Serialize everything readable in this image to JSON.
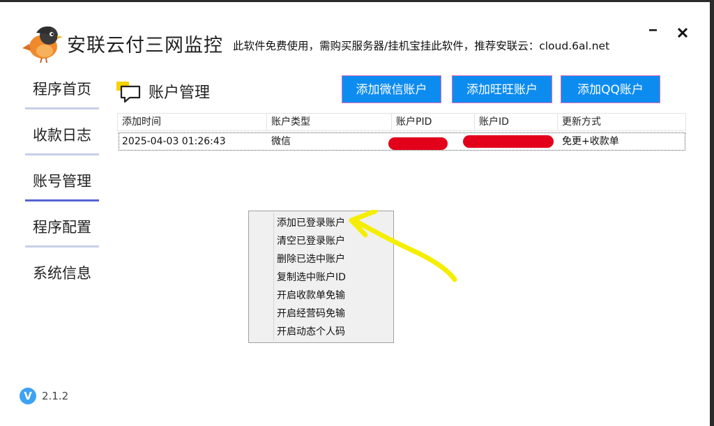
{
  "window": {
    "title": "安联云付三网监控",
    "tagline": "此软件免费使用，需购买服务器/挂机宝挂此软件，推荐安联云：cloud.6al.net",
    "minimize_glyph": "–",
    "close_glyph": "✕"
  },
  "sidebar": {
    "items": [
      {
        "label": "程序首页",
        "active": false
      },
      {
        "label": "收款日志",
        "active": false
      },
      {
        "label": "账号管理",
        "active": true
      },
      {
        "label": "程序配置",
        "active": false
      },
      {
        "label": "系统信息",
        "active": false
      }
    ]
  },
  "main": {
    "section_title": "账户管理",
    "buttons": {
      "add_wechat": "添加微信账户",
      "add_wangwang": "添加旺旺账户",
      "add_qq": "添加QQ账户"
    },
    "table": {
      "columns": [
        "添加时间",
        "账户类型",
        "账户PID",
        "账户ID",
        "更新方式"
      ],
      "rows": [
        {
          "time": "2025-04-03 01:26:43",
          "type": "微信",
          "pid": "",
          "id": "",
          "update": "免更+收款单"
        }
      ]
    },
    "context_menu": {
      "items": [
        "添加已登录账户",
        "清空已登录账户",
        "删除已选中账户",
        "复制选中账户ID",
        "开启收款单免输",
        "开启经营码免输",
        "开启动态个人码"
      ]
    }
  },
  "version": {
    "icon_letter": "V",
    "number": "2.1.2"
  },
  "colors": {
    "accent_button": "#0d8cf0",
    "nav_active_underline": "#5563cf",
    "nav_underline": "#c7d0e8",
    "redaction": "#e2001a",
    "annotation_arrow": "#f5ee00"
  },
  "icons": {
    "logo": "bird-logo-icon",
    "section": "chat-bubble-icon",
    "version": "version-badge-icon"
  }
}
